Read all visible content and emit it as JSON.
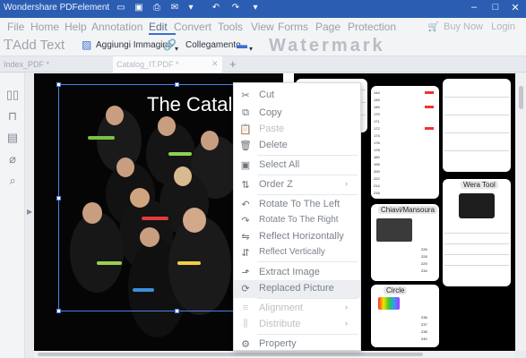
{
  "window": {
    "title": "Wondershare PDFelement",
    "minimize": "–",
    "restore": "□",
    "close": "✕"
  },
  "menu": {
    "items": [
      "File",
      "Home",
      "Help",
      "Annotation",
      "Edit",
      "Convert",
      "Tools",
      "View",
      "Forms",
      "Page",
      "Protection"
    ],
    "active": "Edit",
    "buy_now": "Buy Now",
    "login": "Login"
  },
  "toolbar": {
    "add_text": "Add Text",
    "add_image": "Aggiungi Immagini",
    "link": "Collegamento",
    "watermark": "Watermark"
  },
  "tabs": [
    {
      "label": "Index_PDF *",
      "active": false
    },
    {
      "label": "Catalog_IT.PDF *",
      "active": true
    }
  ],
  "document": {
    "catalog_title": "The Catalo"
  },
  "catalog_page": {
    "panel_titles": [
      "Chiavi/Mansoura",
      "Wera Tool",
      "Circle"
    ],
    "row_numbers_a": [
      "144",
      "145",
      "146",
      "170",
      "171",
      "172",
      "174",
      "176",
      "178",
      "180",
      "195",
      "200",
      "222",
      "214",
      "216"
    ],
    "row_numbers_b": [
      "226",
      "228",
      "229",
      "234"
    ],
    "row_numbers_c": [
      "236",
      "237",
      "238",
      "240"
    ]
  },
  "context_menu": {
    "items": [
      {
        "label": "Cut",
        "icon": "cut-icon",
        "glyph": "✂",
        "disabled": false,
        "submenu": false
      },
      {
        "label": "Copy",
        "icon": "copy-icon",
        "glyph": "⧉",
        "disabled": false,
        "submenu": false
      },
      {
        "label": "Paste",
        "icon": "paste-icon",
        "glyph": "📋",
        "disabled": true,
        "submenu": false
      },
      {
        "label": "Delete",
        "icon": "trash-icon",
        "glyph": "🗑",
        "disabled": false,
        "submenu": false
      },
      {
        "label": "Select All",
        "icon": "select-all-icon",
        "glyph": "▣",
        "disabled": false,
        "submenu": false
      },
      {
        "label": "Order Z",
        "icon": "order-icon",
        "glyph": "⇅",
        "disabled": false,
        "submenu": true
      },
      {
        "label": "Rotate To The Left",
        "icon": "rotate-left-icon",
        "glyph": "↶",
        "disabled": false,
        "submenu": false
      },
      {
        "label": "Rotate To The Right",
        "icon": "rotate-right-icon",
        "glyph": "↷",
        "disabled": false,
        "submenu": false
      },
      {
        "label": "Reflect Horizontally",
        "icon": "flip-horizontal-icon",
        "glyph": "⇋",
        "disabled": false,
        "submenu": false
      },
      {
        "label": "Reflect Vertically",
        "icon": "flip-vertical-icon",
        "glyph": "⇵",
        "disabled": false,
        "submenu": false
      },
      {
        "label": "Extract Image",
        "icon": "extract-image-icon",
        "glyph": "⬏",
        "disabled": false,
        "submenu": false
      },
      {
        "label": "Replaced Picture",
        "icon": "replace-image-icon",
        "glyph": "⟳",
        "disabled": false,
        "submenu": false
      },
      {
        "label": "Alignment",
        "icon": "align-icon",
        "glyph": "≡",
        "disabled": true,
        "submenu": true
      },
      {
        "label": "Distribute",
        "icon": "distribute-icon",
        "glyph": "⫼",
        "disabled": true,
        "submenu": true
      },
      {
        "label": "Property",
        "icon": "gear-icon",
        "glyph": "⚙",
        "disabled": false,
        "submenu": false
      }
    ]
  }
}
